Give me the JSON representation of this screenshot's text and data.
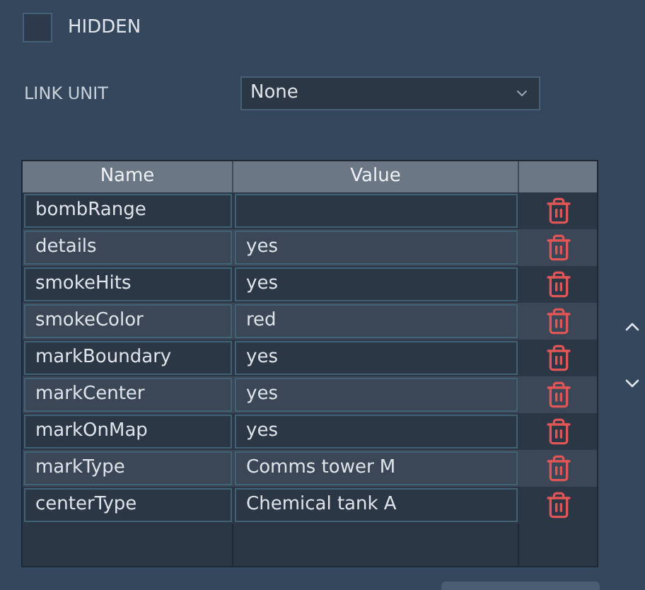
{
  "hidden": {
    "label": "HIDDEN",
    "checked": false
  },
  "link_unit": {
    "label": "LINK UNIT",
    "value": "None"
  },
  "table": {
    "columns": [
      "Name",
      "Value"
    ],
    "rows": [
      {
        "name": "bombRange",
        "value": ""
      },
      {
        "name": "details",
        "value": "yes"
      },
      {
        "name": "smokeHits",
        "value": "yes"
      },
      {
        "name": "smokeColor",
        "value": "red"
      },
      {
        "name": "markBoundary",
        "value": "yes"
      },
      {
        "name": "markCenter",
        "value": "yes"
      },
      {
        "name": "markOnMap",
        "value": "yes"
      },
      {
        "name": "markType",
        "value": "Comms tower M"
      },
      {
        "name": "centerType",
        "value": "Chemical tank A"
      }
    ]
  }
}
